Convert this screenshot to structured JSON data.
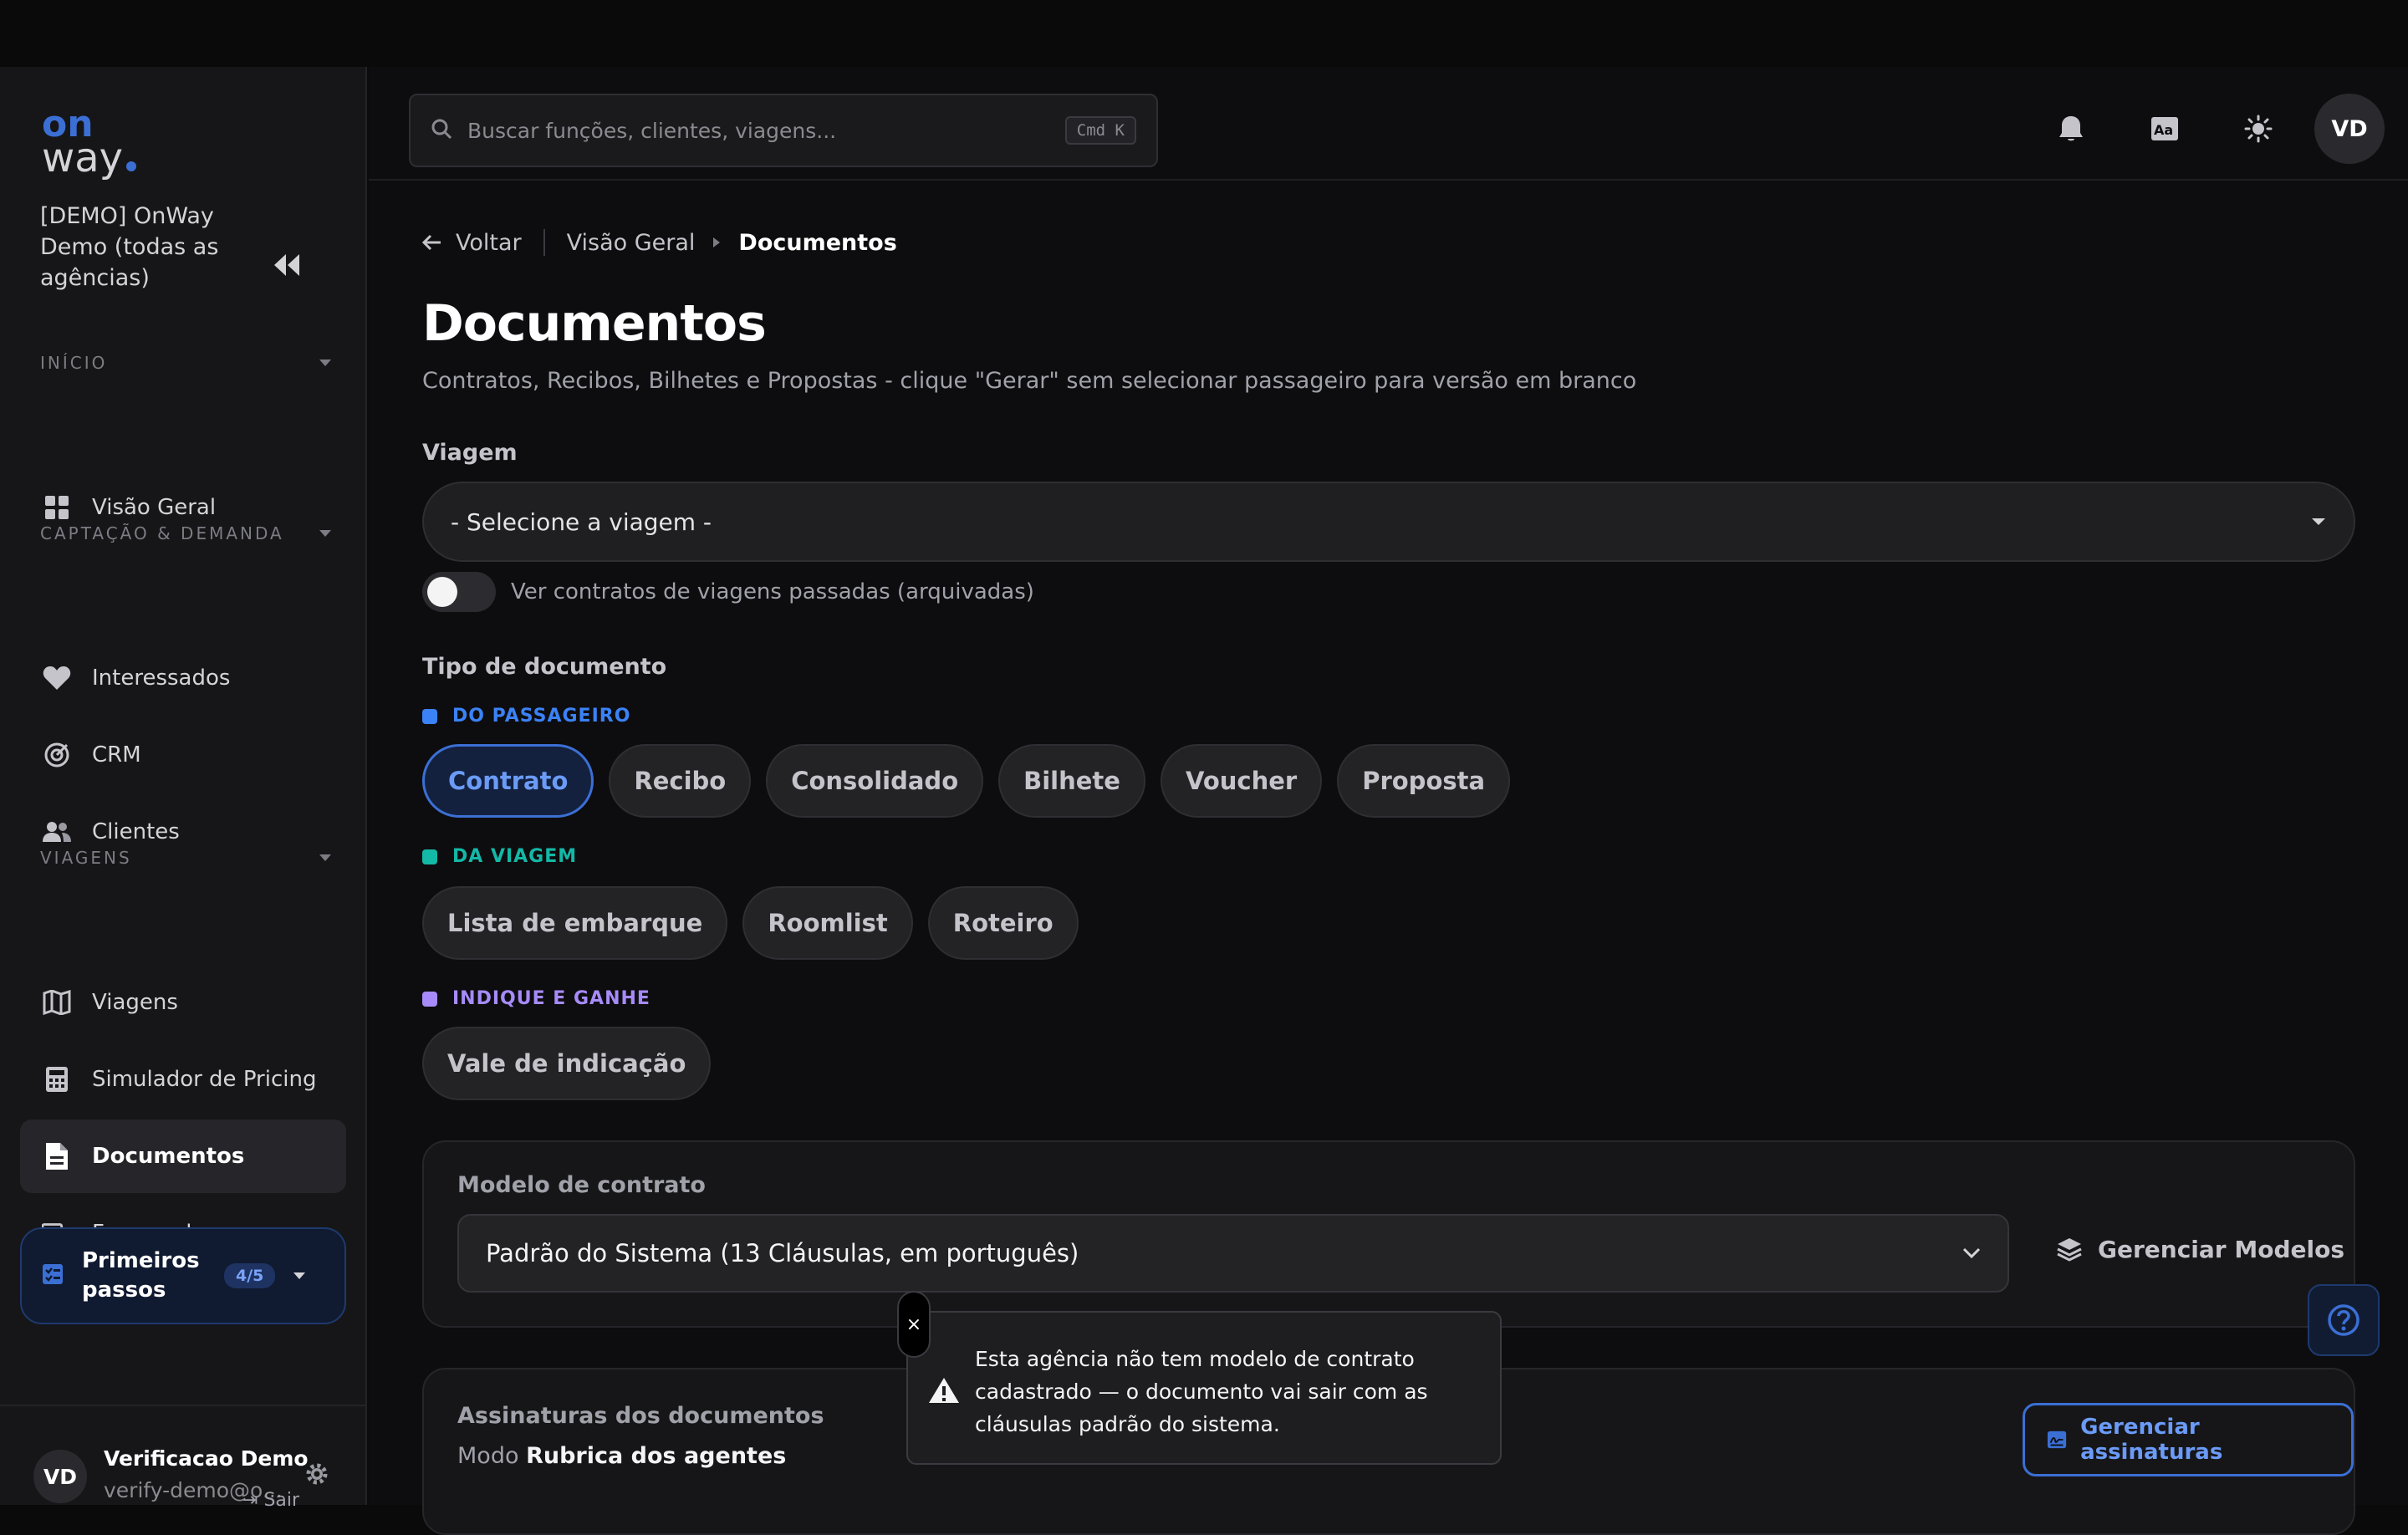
{
  "sidebar": {
    "logo_top": "on",
    "logo_bottom": "way",
    "org_name": "[DEMO] OnWay Demo (todas as agências)",
    "sections": {
      "inicio": "INÍCIO",
      "captacao": "CAPTAÇÃO & DEMANDA",
      "viagens": "VIAGENS"
    },
    "items": [
      {
        "label": "Visão Geral",
        "icon": "grid-icon"
      },
      {
        "label": "Interessados",
        "icon": "heart-icon"
      },
      {
        "label": "CRM",
        "icon": "target-icon"
      },
      {
        "label": "Clientes",
        "icon": "users-icon"
      },
      {
        "label": "Viagens",
        "icon": "map-icon"
      },
      {
        "label": "Simulador de Pricing",
        "icon": "calculator-icon"
      },
      {
        "label": "Documentos",
        "icon": "document-icon"
      },
      {
        "label": "Fornecedores",
        "icon": "truck-icon"
      }
    ],
    "first_steps": {
      "label": "Primeiros passos",
      "progress": "4/5"
    },
    "user": {
      "initials": "VD",
      "name": "Verificacao Demo",
      "email": "verify-demo@o..."
    },
    "logout": "Sair"
  },
  "header": {
    "search_placeholder": "Buscar funções, clientes, viagens...",
    "shortcut": "Cmd  K",
    "avatar": "VD"
  },
  "breadcrumb": {
    "back": "Voltar",
    "parent": "Visão Geral",
    "current": "Documentos"
  },
  "page": {
    "title": "Documentos",
    "subtitle": "Contratos, Recibos, Bilhetes e Propostas - clique \"Gerar\" sem selecionar passageiro para versão em branco"
  },
  "trip": {
    "label": "Viagem",
    "selected": "- Selecione a viagem -",
    "archived_toggle_label": "Ver contratos de viagens passadas (arquivadas)",
    "archived_toggle_on": false
  },
  "doc_type": {
    "label": "Tipo de documento",
    "groups": [
      {
        "title": "DO PASSAGEIRO",
        "color": "#3b82f6",
        "items": [
          "Contrato",
          "Recibo",
          "Consolidado",
          "Bilhete",
          "Voucher",
          "Proposta"
        ]
      },
      {
        "title": "DA VIAGEM",
        "color": "#14b8a6",
        "items": [
          "Lista de embarque",
          "Roomlist",
          "Roteiro"
        ]
      },
      {
        "title": "INDIQUE E GANHE",
        "color": "#a78bfa",
        "items": [
          "Vale de indicação"
        ]
      }
    ],
    "selected": "Contrato"
  },
  "contract_model": {
    "label": "Modelo de contrato",
    "selected": "Padrão do Sistema (13 Cláusulas, em português)",
    "manage_label": "Gerenciar Modelos"
  },
  "signatures": {
    "label": "Assinaturas dos documentos",
    "mode_prefix": "Modo",
    "mode_value": "Rubrica dos agentes",
    "manage_label": "Gerenciar assinaturas"
  },
  "toast": {
    "close": "×",
    "message": "Esta agência não tem modelo de contrato cadastrado — o documento vai sair com as cláusulas padrão do sistema."
  },
  "colors": {
    "accent": "#3b6fd4",
    "accent_text": "#6b9bf7",
    "logo": "#3b6fd4"
  }
}
